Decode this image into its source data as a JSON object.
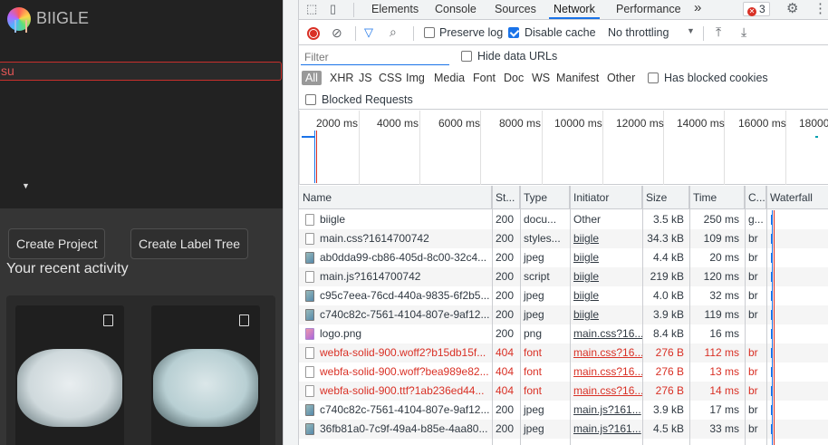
{
  "app": {
    "brand": "BIIGLE",
    "search_value": "su",
    "nav_icons": [
      "",
      "",
      ""
    ],
    "create_project": " Create Project",
    "create_label_tree": " Create Label Tree",
    "recent_activity": "Your recent activity"
  },
  "devtools": {
    "tabs": [
      "Elements",
      "Console",
      "Sources",
      "Network",
      "Performance"
    ],
    "active_tab": "Network",
    "more": "»",
    "error_count": "3",
    "controls": {
      "preserve_log": "Preserve log",
      "disable_cache": "Disable cache",
      "throttling": "No throttling"
    },
    "filter": {
      "placeholder": "Filter",
      "hide_data_urls": "Hide data URLs",
      "types": [
        "All",
        "XHR",
        "JS",
        "CSS",
        "Img",
        "Media",
        "Font",
        "Doc",
        "WS",
        "Manifest",
        "Other"
      ],
      "has_blocked_cookies": "Has blocked cookies",
      "blocked_requests": "Blocked Requests"
    },
    "timeline_ticks": [
      "2000 ms",
      "4000 ms",
      "6000 ms",
      "8000 ms",
      "10000 ms",
      "12000 ms",
      "14000 ms",
      "16000 ms",
      "18000"
    ],
    "columns": [
      "Name",
      "St...",
      "Type",
      "Initiator",
      "Size",
      "Time",
      "C...",
      "Waterfall"
    ],
    "rows": [
      {
        "name": "biigle",
        "status": "200",
        "type": "docu...",
        "initiator": "Other",
        "size": "3.5 kB",
        "time": "250 ms",
        "c": "g...",
        "icon": "doc",
        "error": false,
        "link": false
      },
      {
        "name": "main.css?1614700742",
        "status": "200",
        "type": "styles...",
        "initiator": "biigle",
        "size": "34.3 kB",
        "time": "109 ms",
        "c": "br",
        "icon": "doc",
        "error": false,
        "link": true
      },
      {
        "name": "ab0dda99-cb86-405d-8c00-32c4...",
        "status": "200",
        "type": "jpeg",
        "initiator": "biigle",
        "size": "4.4 kB",
        "time": "20 ms",
        "c": "br",
        "icon": "img",
        "error": false,
        "link": true
      },
      {
        "name": "main.js?1614700742",
        "status": "200",
        "type": "script",
        "initiator": "biigle",
        "size": "219 kB",
        "time": "120 ms",
        "c": "br",
        "icon": "doc",
        "error": false,
        "link": true
      },
      {
        "name": "c95c7eea-76cd-440a-9835-6f2b5...",
        "status": "200",
        "type": "jpeg",
        "initiator": "biigle",
        "size": "4.0 kB",
        "time": "32 ms",
        "c": "br",
        "icon": "img",
        "error": false,
        "link": true
      },
      {
        "name": "c740c82c-7561-4104-807e-9af12...",
        "status": "200",
        "type": "jpeg",
        "initiator": "biigle",
        "size": "3.9 kB",
        "time": "119 ms",
        "c": "br",
        "icon": "img",
        "error": false,
        "link": true
      },
      {
        "name": "logo.png",
        "status": "200",
        "type": "png",
        "initiator": "main.css?16...",
        "size": "8.4 kB",
        "time": "16 ms",
        "c": "",
        "icon": "png",
        "error": false,
        "link": true
      },
      {
        "name": "webfa-solid-900.woff2?b15db15f...",
        "status": "404",
        "type": "font",
        "initiator": "main.css?16...",
        "size": "276 B",
        "time": "112 ms",
        "c": "br",
        "icon": "doc",
        "error": true,
        "link": true
      },
      {
        "name": "webfa-solid-900.woff?bea989e82...",
        "status": "404",
        "type": "font",
        "initiator": "main.css?16...",
        "size": "276 B",
        "time": "13 ms",
        "c": "br",
        "icon": "doc",
        "error": true,
        "link": true
      },
      {
        "name": "webfa-solid-900.ttf?1ab236ed44...",
        "status": "404",
        "type": "font",
        "initiator": "main.css?16...",
        "size": "276 B",
        "time": "14 ms",
        "c": "br",
        "icon": "doc",
        "error": true,
        "link": true
      },
      {
        "name": "c740c82c-7561-4104-807e-9af12...",
        "status": "200",
        "type": "jpeg",
        "initiator": "main.js?161...",
        "size": "3.9 kB",
        "time": "17 ms",
        "c": "br",
        "icon": "img",
        "error": false,
        "link": true
      },
      {
        "name": "36fb81a0-7c9f-49a4-b85e-4aa80...",
        "status": "200",
        "type": "jpeg",
        "initiator": "main.js?161...",
        "size": "4.5 kB",
        "time": "33 ms",
        "c": "br",
        "icon": "img",
        "error": false,
        "link": true
      }
    ]
  }
}
